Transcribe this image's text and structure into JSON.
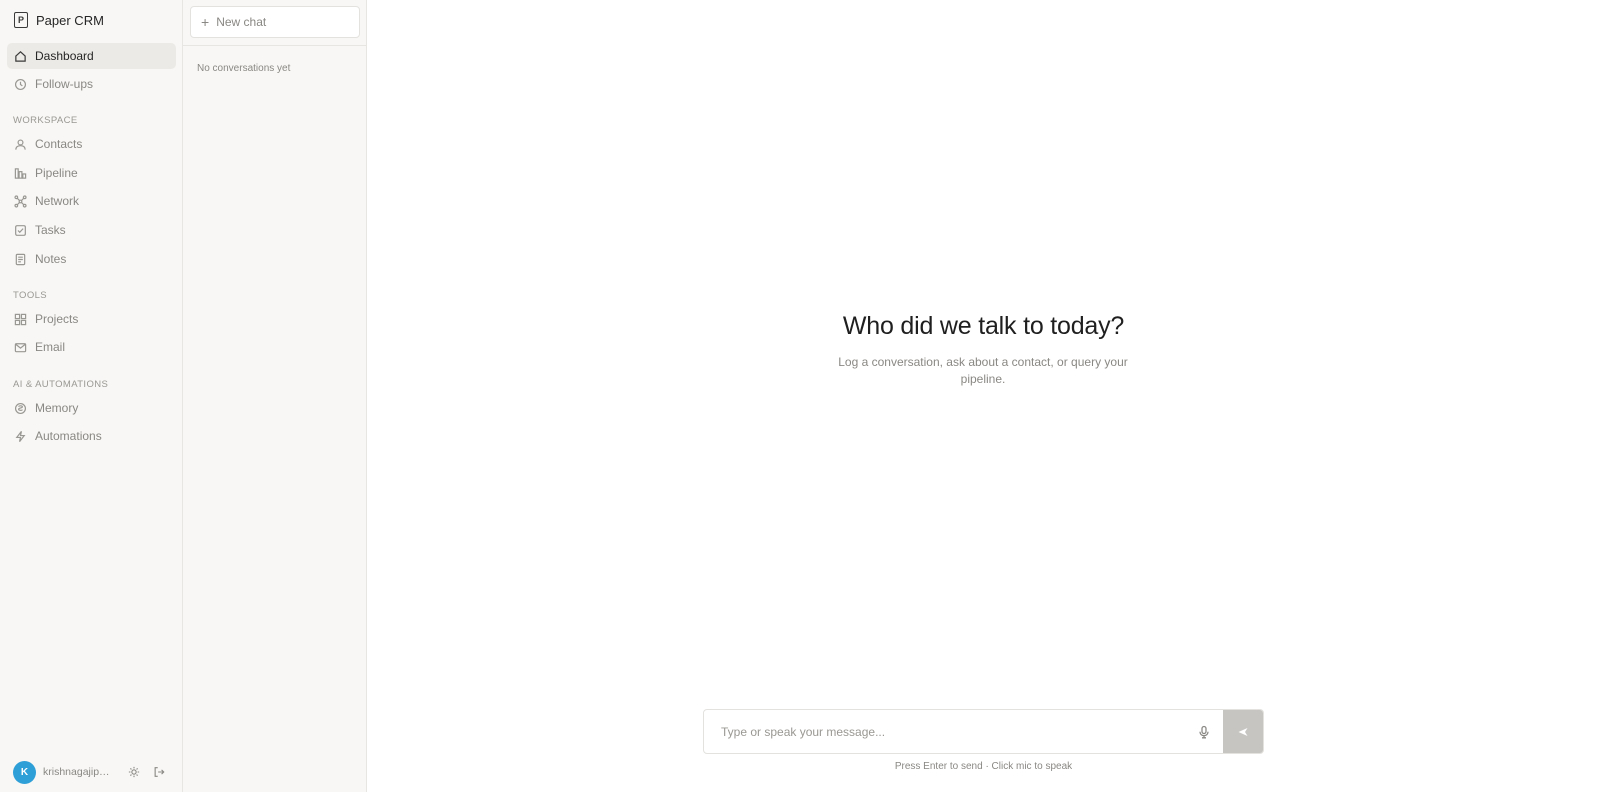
{
  "brand": {
    "name": "Paper CRM",
    "logo_letter": "P"
  },
  "nav": {
    "top": [
      {
        "label": "Dashboard",
        "icon": "home-icon",
        "active": true
      },
      {
        "label": "Follow-ups",
        "icon": "clock-icon",
        "active": false
      }
    ],
    "workspace_label": "WORKSPACE",
    "workspace": [
      {
        "label": "Contacts",
        "icon": "user-icon"
      },
      {
        "label": "Pipeline",
        "icon": "pipeline-icon"
      },
      {
        "label": "Network",
        "icon": "network-icon"
      },
      {
        "label": "Tasks",
        "icon": "checkbox-icon"
      },
      {
        "label": "Notes",
        "icon": "note-icon"
      }
    ],
    "tools_label": "TOOLS",
    "tools": [
      {
        "label": "Projects",
        "icon": "grid-icon"
      },
      {
        "label": "Email",
        "icon": "mail-icon"
      }
    ],
    "ai_label": "AI & AUTOMATIONS",
    "ai": [
      {
        "label": "Memory",
        "icon": "memory-icon"
      },
      {
        "label": "Automations",
        "icon": "bolt-icon"
      }
    ]
  },
  "user": {
    "initial": "K",
    "name": "krishnagajipar...",
    "avatar_color": "#2f9fd8"
  },
  "conversations": {
    "new_chat_label": "New chat",
    "empty_text": "No conversations yet"
  },
  "main": {
    "title": "Who did we talk to today?",
    "subtitle": "Log a conversation, ask about a contact, or query your pipeline."
  },
  "composer": {
    "placeholder": "Type or speak your message...",
    "value": "",
    "hint": "Press Enter to send · Click mic to speak"
  }
}
